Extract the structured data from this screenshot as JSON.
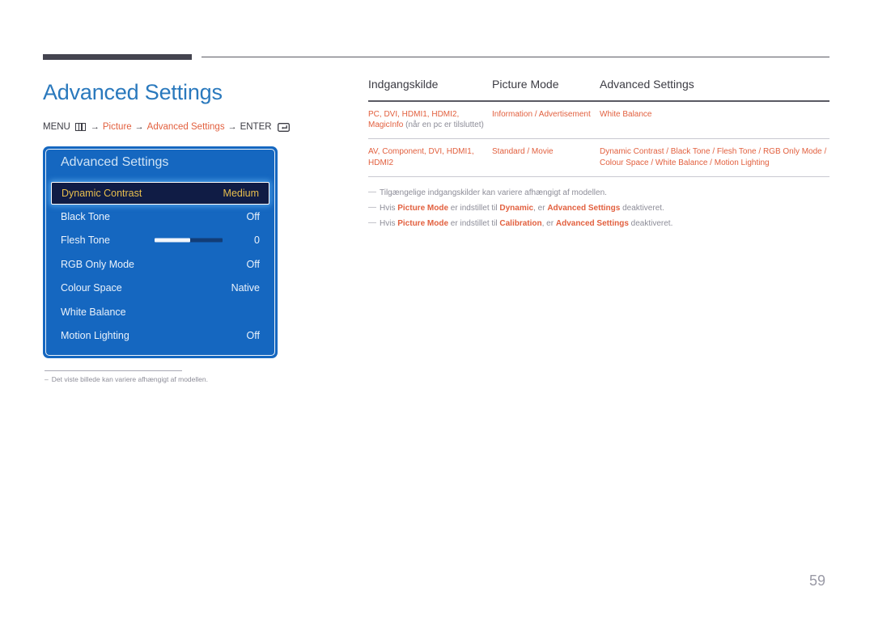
{
  "page": {
    "title": "Advanced Settings",
    "number": "59"
  },
  "breadcrumb": {
    "menu_label": "MENU",
    "menu_icon": "menu-grid-icon",
    "arrow": "→",
    "items": [
      "Picture",
      "Advanced Settings"
    ],
    "enter_label": "ENTER",
    "enter_icon": "enter-return-icon"
  },
  "osd": {
    "title": "Advanced Settings",
    "rows": [
      {
        "label": "Dynamic Contrast",
        "value": "Medium",
        "selected": true,
        "slider": null
      },
      {
        "label": "Black Tone",
        "value": "Off",
        "selected": false,
        "slider": null
      },
      {
        "label": "Flesh Tone",
        "value": "0",
        "selected": false,
        "slider": 52
      },
      {
        "label": "RGB Only Mode",
        "value": "Off",
        "selected": false,
        "slider": null
      },
      {
        "label": "Colour Space",
        "value": "Native",
        "selected": false,
        "slider": null
      },
      {
        "label": "White Balance",
        "value": "",
        "selected": false,
        "slider": null
      },
      {
        "label": "Motion Lighting",
        "value": "Off",
        "selected": false,
        "slider": null
      }
    ]
  },
  "left_footnote": {
    "dash": "–",
    "text": "Det viste billede kan variere afhængigt af modellen."
  },
  "table": {
    "headers": [
      "Indgangskilde",
      "Picture Mode",
      "Advanced Settings"
    ],
    "rows": [
      {
        "source_main": "PC, DVI, HDMI1, HDMI2, MagicInfo",
        "source_note": " (når en pc er tilsluttet)",
        "picture_mode": "Information / Advertisement",
        "advanced": "White Balance"
      },
      {
        "source_main": "AV, Component, DVI, HDMI1, HDMI2",
        "source_note": "",
        "picture_mode": "Standard / Movie",
        "advanced": "Dynamic Contrast / Black Tone / Flesh Tone / RGB Only Mode / Colour Space / White Balance / Motion Lighting"
      }
    ]
  },
  "notes": [
    {
      "dash": "—",
      "parts": [
        {
          "t": "Tilgængelige indgangskilder kan variere afhængigt af modellen.",
          "s": "plain"
        }
      ]
    },
    {
      "dash": "—",
      "parts": [
        {
          "t": "Hvis ",
          "s": "plain"
        },
        {
          "t": "Picture Mode",
          "s": "bold"
        },
        {
          "t": " er indstillet til ",
          "s": "plain"
        },
        {
          "t": "Dynamic",
          "s": "bold"
        },
        {
          "t": ", er ",
          "s": "plain"
        },
        {
          "t": "Advanced Settings",
          "s": "bold"
        },
        {
          "t": " deaktiveret.",
          "s": "plain"
        }
      ]
    },
    {
      "dash": "—",
      "parts": [
        {
          "t": "Hvis ",
          "s": "plain"
        },
        {
          "t": "Picture Mode",
          "s": "bold"
        },
        {
          "t": " er indstillet til ",
          "s": "plain"
        },
        {
          "t": "Calibration",
          "s": "bold"
        },
        {
          "t": ", er ",
          "s": "plain"
        },
        {
          "t": "Advanced Settings",
          "s": "bold"
        },
        {
          "t": " deaktiveret.",
          "s": "plain"
        }
      ]
    }
  ],
  "colors": {
    "title_blue": "#2a79bd",
    "accent_orange": "#e2603f",
    "osd_blue": "#1567c0",
    "osd_selected_bg": "#101c45",
    "osd_selected_text": "#e8bf4e",
    "rule_dark": "#44444f",
    "muted_gray": "#8d8d98"
  }
}
